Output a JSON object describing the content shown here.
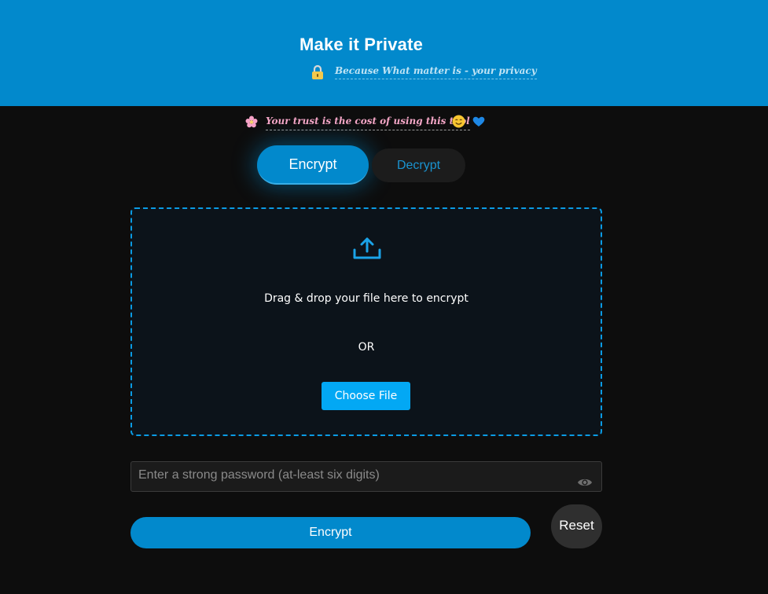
{
  "header": {
    "title": "Make it Private",
    "subtitle": "Because What matter is - your privacy",
    "icon": "lock-icon",
    "background_color": "#0289cc"
  },
  "trust_note": {
    "text": "Your trust is the cost of using this tool",
    "leading_icon": "flower-icon",
    "trailing_icons": [
      "smile-icon",
      "heart-icon"
    ]
  },
  "tabs": [
    {
      "label": "Encrypt",
      "active": true
    },
    {
      "label": "Decrypt",
      "active": false
    }
  ],
  "dropzone": {
    "icon": "upload-icon",
    "prompt": "Drag & drop your file here to encrypt",
    "separator": "OR",
    "choose_label": "Choose File",
    "border_color": "#0a9be4"
  },
  "password": {
    "placeholder": "Enter a strong password (at-least six digits)",
    "value": "",
    "toggle_icon": "eye-icon"
  },
  "actions": {
    "submit_label": "Encrypt",
    "reset_label": "Reset"
  },
  "colors": {
    "accent": "#0289cc",
    "button_blue": "#03a8f4",
    "page_background": "#0d0d0d"
  }
}
